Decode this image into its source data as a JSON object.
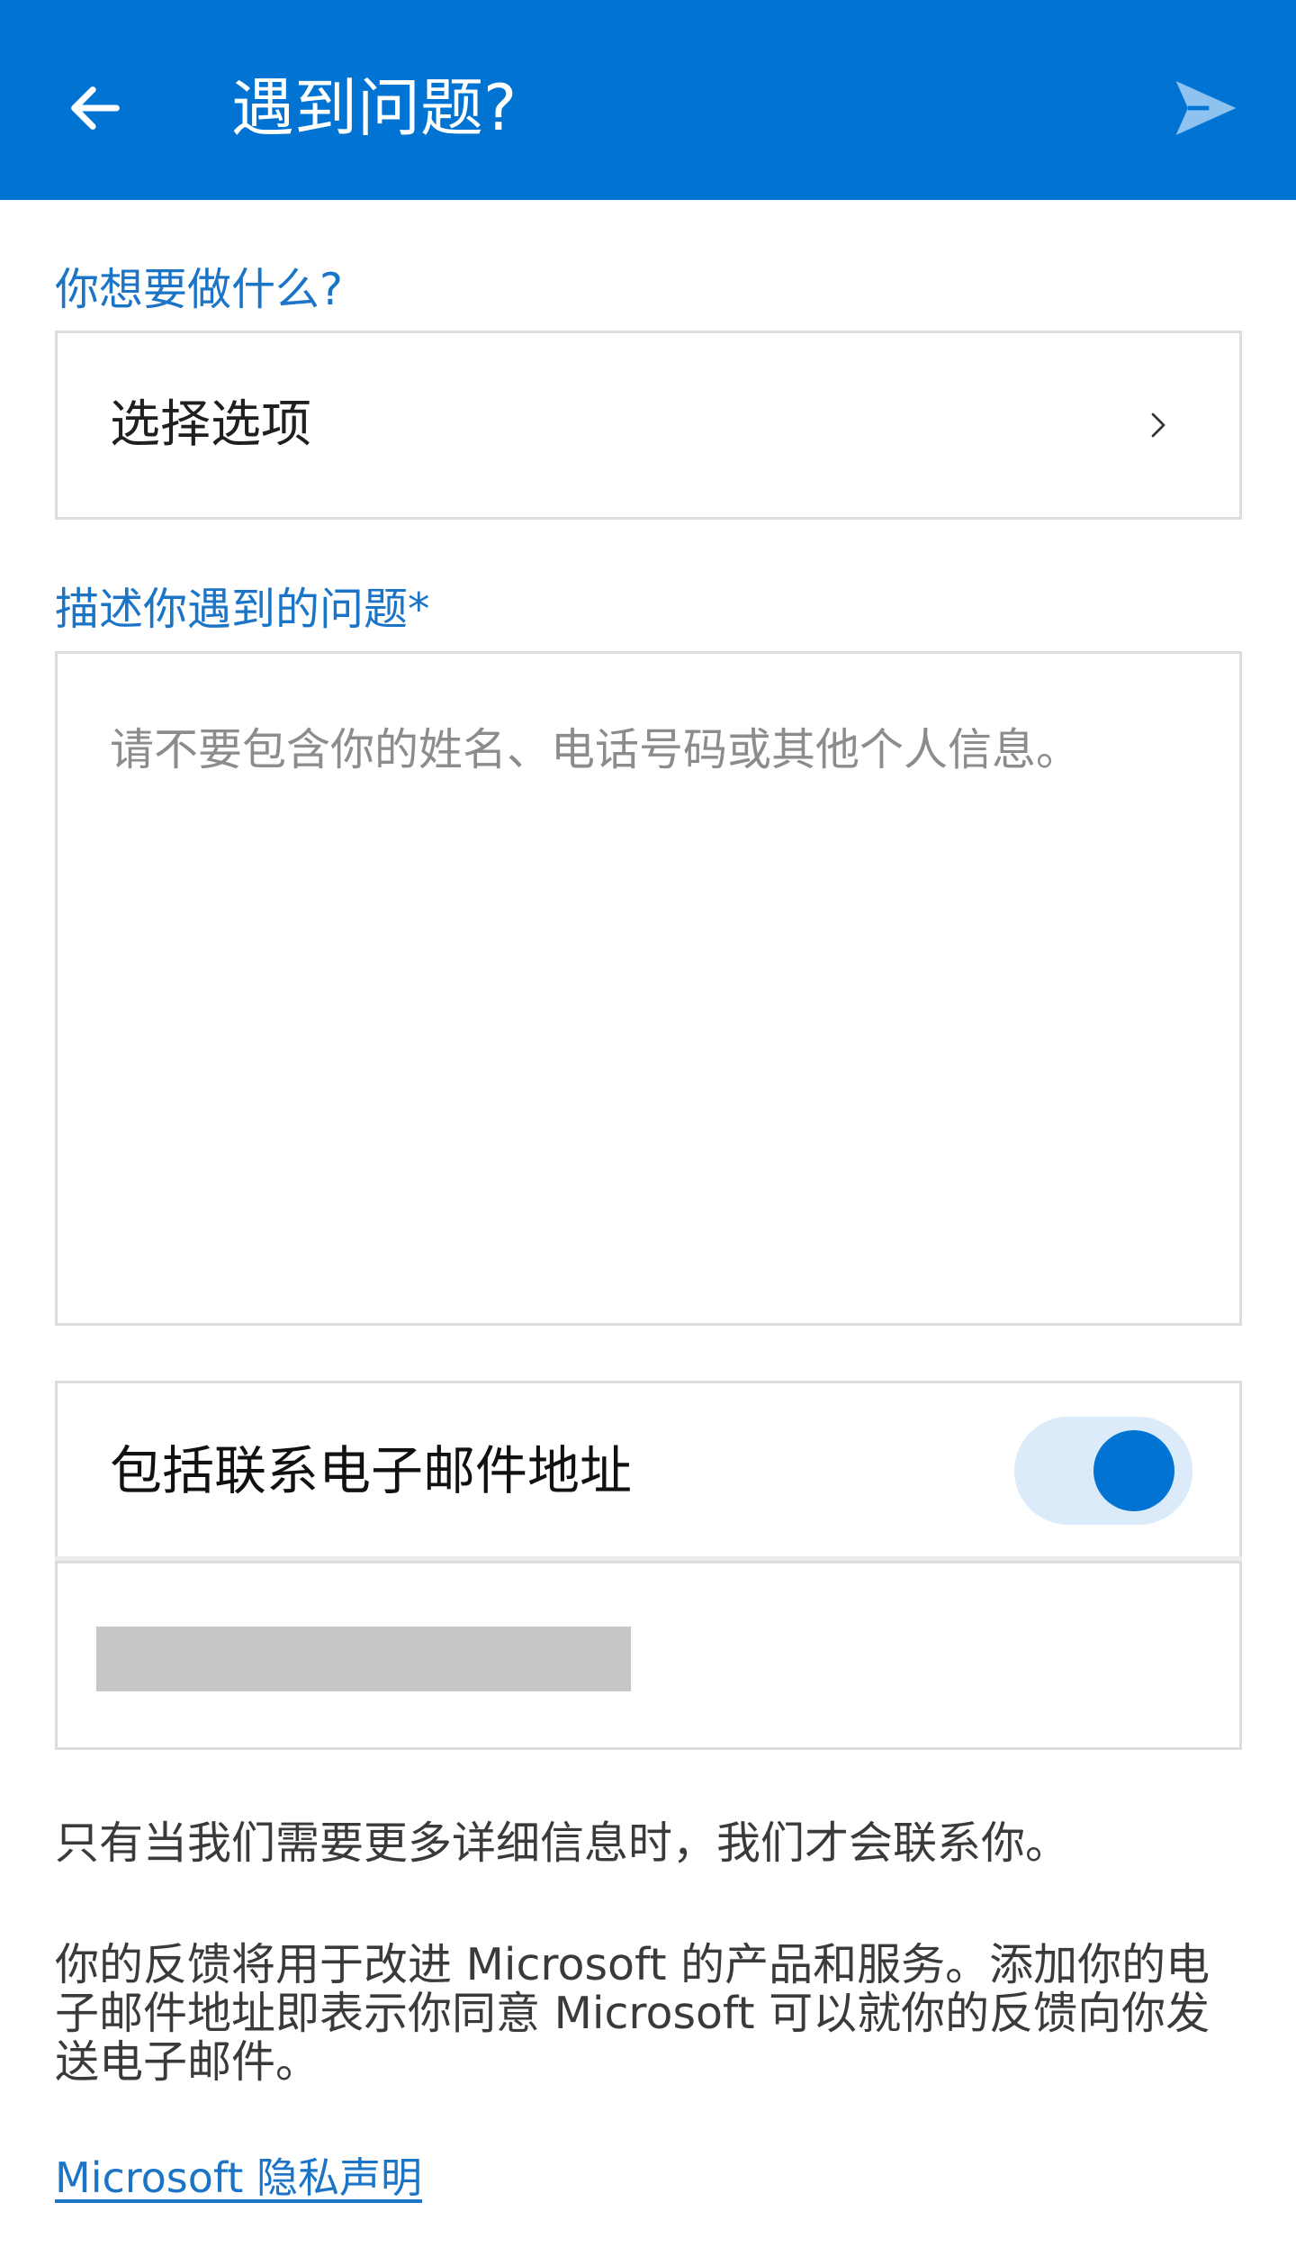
{
  "app_bar": {
    "title": "遇到问题?",
    "back_icon": "arrow-left-icon",
    "send_icon": "send-icon",
    "color": "#0174d3"
  },
  "action": {
    "label": "你想要做什么?",
    "select_value": "选择选项",
    "chevron_icon": "chevron-right-icon"
  },
  "description": {
    "label": "描述你遇到的问题*",
    "placeholder": "请不要包含你的姓名、电话号码或其他个人信息。",
    "value": ""
  },
  "email": {
    "toggle_label": "包括联系电子邮件地址",
    "toggle_on": true,
    "address_redacted": true
  },
  "info": {
    "contact_note": "只有当我们需要更多详细信息时，我们才会联系你。",
    "usage_note": "你的反馈将用于改进 Microsoft 的产品和服务。添加你的电子邮件地址即表示你同意 Microsoft 可以就你的反馈向你发送电子邮件。"
  },
  "privacy_link": "Microsoft 隐私声明"
}
